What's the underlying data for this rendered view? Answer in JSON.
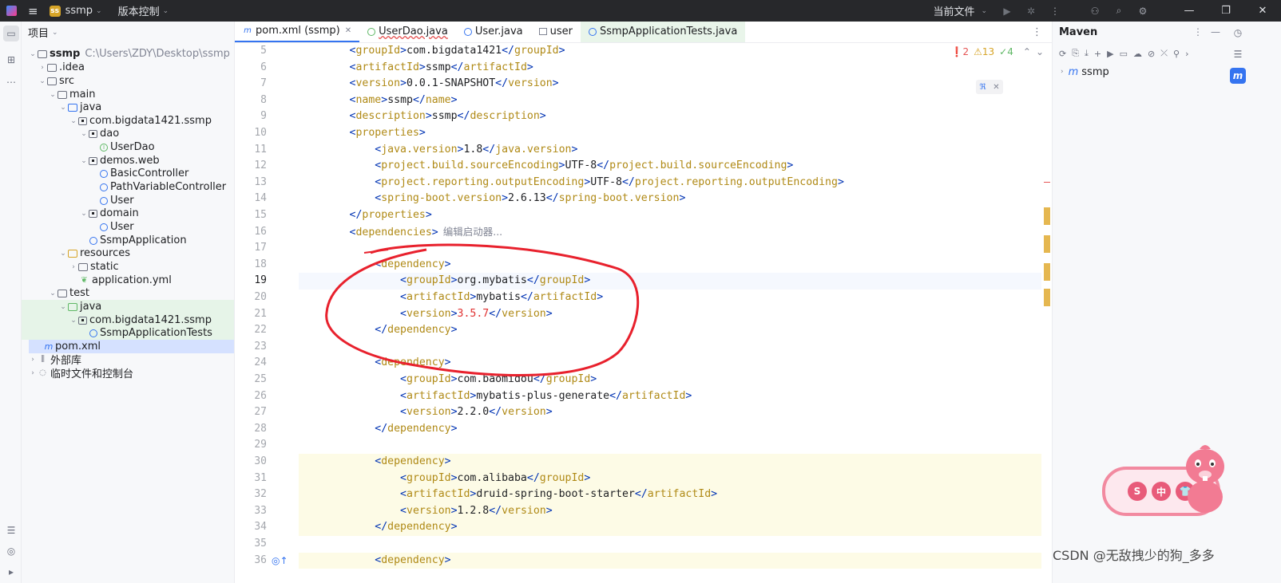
{
  "titlebar": {
    "project_badge": "ss",
    "project_name": "ssmp",
    "vcs_label": "版本控制",
    "current_file_label": "当前文件"
  },
  "project_panel": {
    "title": "项目",
    "root_path": "C:\\Users\\ZDY\\Desktop\\ssmp",
    "items": [
      {
        "label": "ssmp"
      },
      {
        "label": ".idea"
      },
      {
        "label": "src"
      },
      {
        "label": "main"
      },
      {
        "label": "java"
      },
      {
        "label": "com.bigdata1421.ssmp"
      },
      {
        "label": "dao"
      },
      {
        "label": "UserDao"
      },
      {
        "label": "demos.web"
      },
      {
        "label": "BasicController"
      },
      {
        "label": "PathVariableController"
      },
      {
        "label": "User"
      },
      {
        "label": "domain"
      },
      {
        "label": "User"
      },
      {
        "label": "SsmpApplication"
      },
      {
        "label": "resources"
      },
      {
        "label": "static"
      },
      {
        "label": "application.yml"
      },
      {
        "label": "test"
      },
      {
        "label": "java"
      },
      {
        "label": "com.bigdata1421.ssmp"
      },
      {
        "label": "SsmpApplicationTests"
      },
      {
        "label": "pom.xml"
      },
      {
        "label": "外部库"
      },
      {
        "label": "临时文件和控制台"
      }
    ]
  },
  "editor": {
    "tabs": [
      {
        "label": "pom.xml (ssmp)",
        "icon": "maven-icon"
      },
      {
        "label": "UserDao.java",
        "icon": "interface-icon"
      },
      {
        "label": "User.java",
        "icon": "class-icon"
      },
      {
        "label": "user",
        "icon": "table-icon"
      },
      {
        "label": "SsmpApplicationTests.java",
        "icon": "class-icon"
      }
    ],
    "inspections": {
      "errors": "2",
      "warnings": "13",
      "ok": "4"
    },
    "inlay_hint": "编辑启动器...",
    "lines": [
      {
        "n": "5",
        "indent": 4,
        "open": "groupId",
        "text": "com.bigdata1421",
        "close": "groupId"
      },
      {
        "n": "6",
        "indent": 4,
        "open": "artifactId",
        "text": "ssmp",
        "close": "artifactId"
      },
      {
        "n": "7",
        "indent": 4,
        "open": "version",
        "text": "0.0.1-SNAPSHOT",
        "close": "version"
      },
      {
        "n": "8",
        "indent": 4,
        "open": "name",
        "text": "ssmp",
        "close": "name"
      },
      {
        "n": "9",
        "indent": 4,
        "open": "description",
        "text": "ssmp",
        "close": "description"
      },
      {
        "n": "10",
        "indent": 4,
        "open": "properties",
        "text": "",
        "close": ""
      },
      {
        "n": "11",
        "indent": 8,
        "open": "java.version",
        "text": "1.8",
        "close": "java.version"
      },
      {
        "n": "12",
        "indent": 8,
        "open": "project.build.sourceEncoding",
        "text": "UTF-8",
        "close": "project.build.sourceEncoding"
      },
      {
        "n": "13",
        "indent": 8,
        "open": "project.reporting.outputEncoding",
        "text": "UTF-8",
        "close": "project.reporting.outputEncoding"
      },
      {
        "n": "14",
        "indent": 8,
        "open": "spring-boot.version",
        "text": "2.6.13",
        "close": "spring-boot.version"
      },
      {
        "n": "15",
        "indent": 4,
        "open": "",
        "text": "",
        "close": "properties"
      },
      {
        "n": "16",
        "indent": 4,
        "open": "dependencies",
        "text": "",
        "close": "",
        "hint": true
      },
      {
        "n": "17",
        "indent": 0,
        "open": "",
        "text": "",
        "close": ""
      },
      {
        "n": "18",
        "indent": 8,
        "open": "dependency",
        "text": "",
        "close": ""
      },
      {
        "n": "19",
        "indent": 12,
        "open": "groupId",
        "text": "org.mybatis",
        "close": "groupId"
      },
      {
        "n": "20",
        "indent": 12,
        "open": "artifactId",
        "text": "mybatis",
        "close": "artifactId"
      },
      {
        "n": "21",
        "indent": 12,
        "open": "version",
        "text": "3.5.7",
        "close": "version",
        "red": true
      },
      {
        "n": "22",
        "indent": 8,
        "open": "",
        "text": "",
        "close": "dependency"
      },
      {
        "n": "23",
        "indent": 0,
        "open": "",
        "text": "",
        "close": ""
      },
      {
        "n": "24",
        "indent": 8,
        "open": "dependency",
        "text": "",
        "close": ""
      },
      {
        "n": "25",
        "indent": 12,
        "open": "groupId",
        "text": "com.baomidou",
        "close": "groupId"
      },
      {
        "n": "26",
        "indent": 12,
        "open": "artifactId",
        "text": "mybatis-plus-generate",
        "close": "artifactId"
      },
      {
        "n": "27",
        "indent": 12,
        "open": "version",
        "text": "2.2.0",
        "close": "version"
      },
      {
        "n": "28",
        "indent": 8,
        "open": "",
        "text": "",
        "close": "dependency"
      },
      {
        "n": "29",
        "indent": 0,
        "open": "",
        "text": "",
        "close": ""
      },
      {
        "n": "30",
        "indent": 8,
        "open": "dependency",
        "text": "",
        "close": ""
      },
      {
        "n": "31",
        "indent": 12,
        "open": "groupId",
        "text": "com.alibaba",
        "close": "groupId"
      },
      {
        "n": "32",
        "indent": 12,
        "open": "artifactId",
        "text": "druid-spring-boot-starter",
        "close": "artifactId"
      },
      {
        "n": "33",
        "indent": 12,
        "open": "version",
        "text": "1.2.8",
        "close": "version"
      },
      {
        "n": "34",
        "indent": 8,
        "open": "",
        "text": "",
        "close": "dependency"
      },
      {
        "n": "35",
        "indent": 0,
        "open": "",
        "text": "",
        "close": ""
      },
      {
        "n": "36",
        "indent": 8,
        "open": "dependency",
        "text": "",
        "close": ""
      }
    ]
  },
  "maven_panel": {
    "title": "Maven",
    "tree_root": "ssmp"
  },
  "widget": {
    "buttons": [
      "S",
      "中",
      "👕"
    ]
  },
  "watermark": "CSDN @无敌拽少的狗_多多",
  "colors": {
    "tag": "#0033b3",
    "tag_name": "#b08a16",
    "accent": "#3574f0",
    "annotation_red": "#e8212d"
  }
}
